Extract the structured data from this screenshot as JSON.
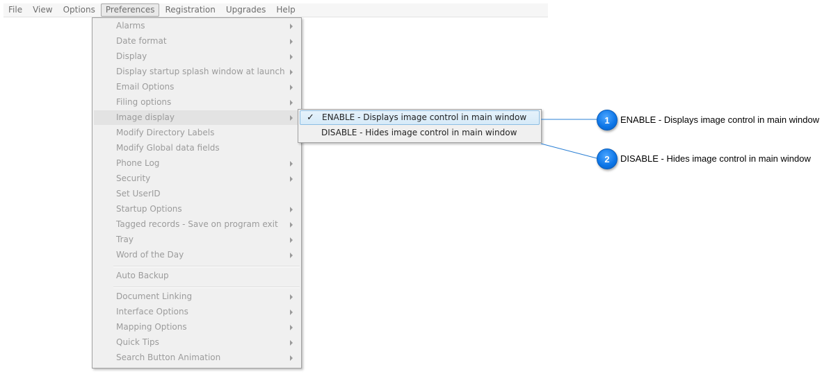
{
  "menubar": {
    "items": [
      "File",
      "View",
      "Options",
      "Preferences",
      "Registration",
      "Upgrades",
      "Help"
    ],
    "open_item": "Preferences"
  },
  "preferences_menu": {
    "items": [
      {
        "label": "Alarms",
        "submenu": true
      },
      {
        "label": "Date format",
        "submenu": true
      },
      {
        "label": "Display",
        "submenu": true
      },
      {
        "label": "Display startup splash window at launch",
        "submenu": true
      },
      {
        "label": "Email Options",
        "submenu": true
      },
      {
        "label": "Filing options",
        "submenu": true
      },
      {
        "label": "Image display",
        "submenu": true,
        "highlighted": true
      },
      {
        "label": "Modify Directory Labels",
        "submenu": false
      },
      {
        "label": "Modify Global data fields",
        "submenu": false
      },
      {
        "label": "Phone Log",
        "submenu": true
      },
      {
        "label": "Security",
        "submenu": true
      },
      {
        "label": "Set UserID",
        "submenu": false
      },
      {
        "label": "Startup Options",
        "submenu": true
      },
      {
        "label": "Tagged records - Save on program exit",
        "submenu": true
      },
      {
        "label": "Tray",
        "submenu": true
      },
      {
        "label": "Word of the Day",
        "submenu": true
      },
      {
        "label": "Auto Backup",
        "submenu": false
      },
      {
        "label": "Document Linking",
        "submenu": true
      },
      {
        "label": "Interface Options",
        "submenu": true
      },
      {
        "label": "Mapping Options",
        "submenu": true
      },
      {
        "label": "Quick Tips",
        "submenu": true
      },
      {
        "label": "Search Button Animation",
        "submenu": true
      }
    ]
  },
  "image_display_submenu": {
    "items": [
      {
        "label": "ENABLE - Displays image control in main window",
        "checked": true
      },
      {
        "label": "DISABLE - Hides image control in main window",
        "checked": false
      }
    ],
    "check_glyph": "✓"
  },
  "callouts": [
    {
      "number": "1",
      "text": "ENABLE - Displays image control in main window"
    },
    {
      "number": "2",
      "text": "DISABLE - Hides image control in main window"
    }
  ],
  "colors": {
    "accent_blue": "#0b74e6",
    "callout_line": "#2a7fd4",
    "disabled_text": "#9b9b9b"
  }
}
